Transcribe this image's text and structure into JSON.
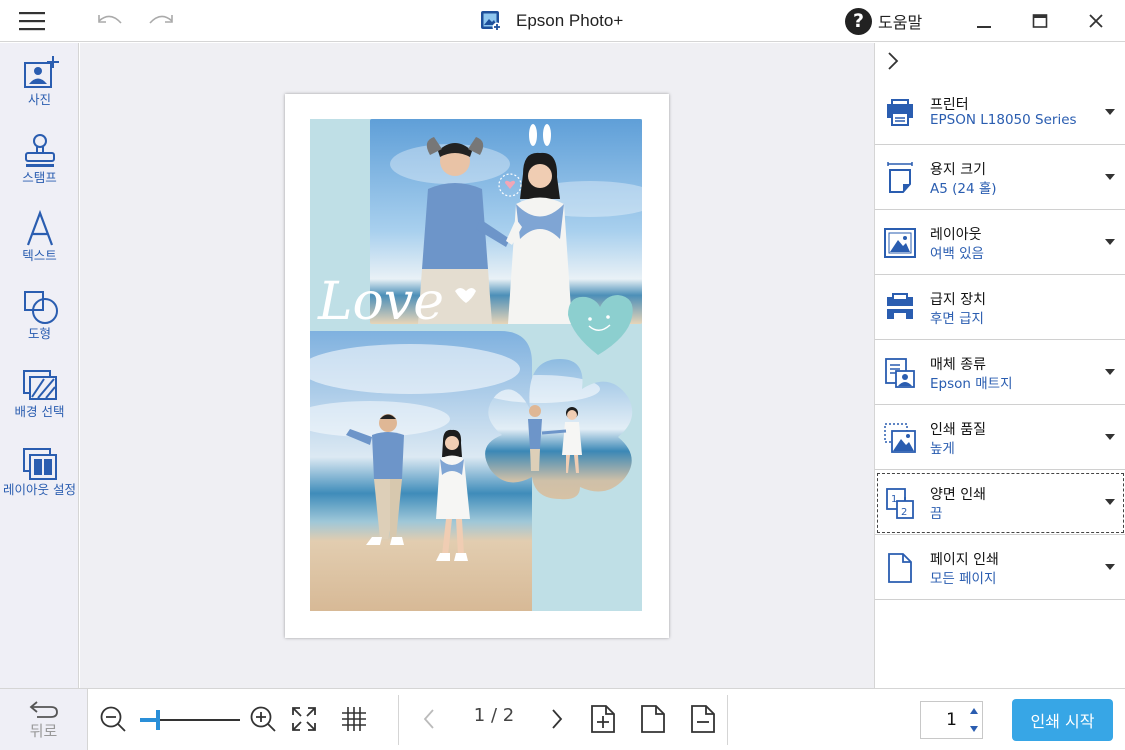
{
  "titlebar": {
    "app_title": "Epson Photo+",
    "help_label": "도움말",
    "help_glyph": "?"
  },
  "tools": [
    {
      "id": "photo",
      "label": "사진",
      "icon": "add-photo-icon"
    },
    {
      "id": "stamp",
      "label": "스탬프",
      "icon": "stamp-icon"
    },
    {
      "id": "text",
      "label": "텍스트",
      "icon": "text-icon"
    },
    {
      "id": "shape",
      "label": "도형",
      "icon": "shape-icon"
    },
    {
      "id": "background",
      "label": "배경 선택",
      "icon": "background-icon"
    },
    {
      "id": "layout",
      "label": "레이아웃 설정",
      "icon": "layout-icon"
    }
  ],
  "canvas": {
    "overlay_text": "Love"
  },
  "settings": [
    {
      "id": "printer",
      "title": "프린터",
      "value": "EPSON L18050 Series",
      "icon": "printer-icon"
    },
    {
      "id": "paper-size",
      "title": "용지 크기",
      "value": "A5 (24 홀)",
      "icon": "paper-size-icon"
    },
    {
      "id": "layout",
      "title": "레이아웃",
      "value": "여백 있음",
      "icon": "layout-border-icon"
    },
    {
      "id": "paper-source",
      "title": "급지 장치",
      "value": "후면 급지",
      "icon": "paper-source-icon"
    },
    {
      "id": "media-type",
      "title": "매체 종류",
      "value": "Epson 매트지",
      "icon": "media-type-icon"
    },
    {
      "id": "print-quality",
      "title": "인쇄 품질",
      "value": "높게",
      "icon": "print-quality-icon"
    },
    {
      "id": "duplex",
      "title": "양면 인쇄",
      "value": "끔",
      "icon": "duplex-icon"
    },
    {
      "id": "page-print",
      "title": "페이지 인쇄",
      "value": "모든 페이지",
      "icon": "page-icon"
    }
  ],
  "bottombar": {
    "back_label": "뒤로",
    "zoom_level": 0.18,
    "page_current": "1",
    "page_total": "2",
    "page_sep": "/",
    "copies": "1",
    "print_label": "인쇄 시작"
  },
  "colors": {
    "accent_blue": "#2a5db0",
    "print_button": "#37a6e6",
    "slider": "#2a8fd8",
    "layout_background": "#bfdfe6"
  }
}
